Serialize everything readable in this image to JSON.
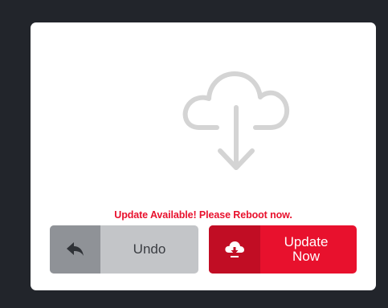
{
  "dialog": {
    "message": "Update Available! Please Reboot now."
  },
  "buttons": {
    "undo": {
      "label": "Undo",
      "icon": "undo-arrow-icon"
    },
    "update": {
      "label": "Update Now",
      "icon": "cloud-download-icon"
    }
  },
  "colors": {
    "background": "#22252b",
    "accent": "#e8112d",
    "accent_dark": "#c10d24",
    "neutral_button": "#c3c5c8",
    "neutral_icon_cell": "#8f9297",
    "cloud_outline": "#d4d4d4"
  }
}
